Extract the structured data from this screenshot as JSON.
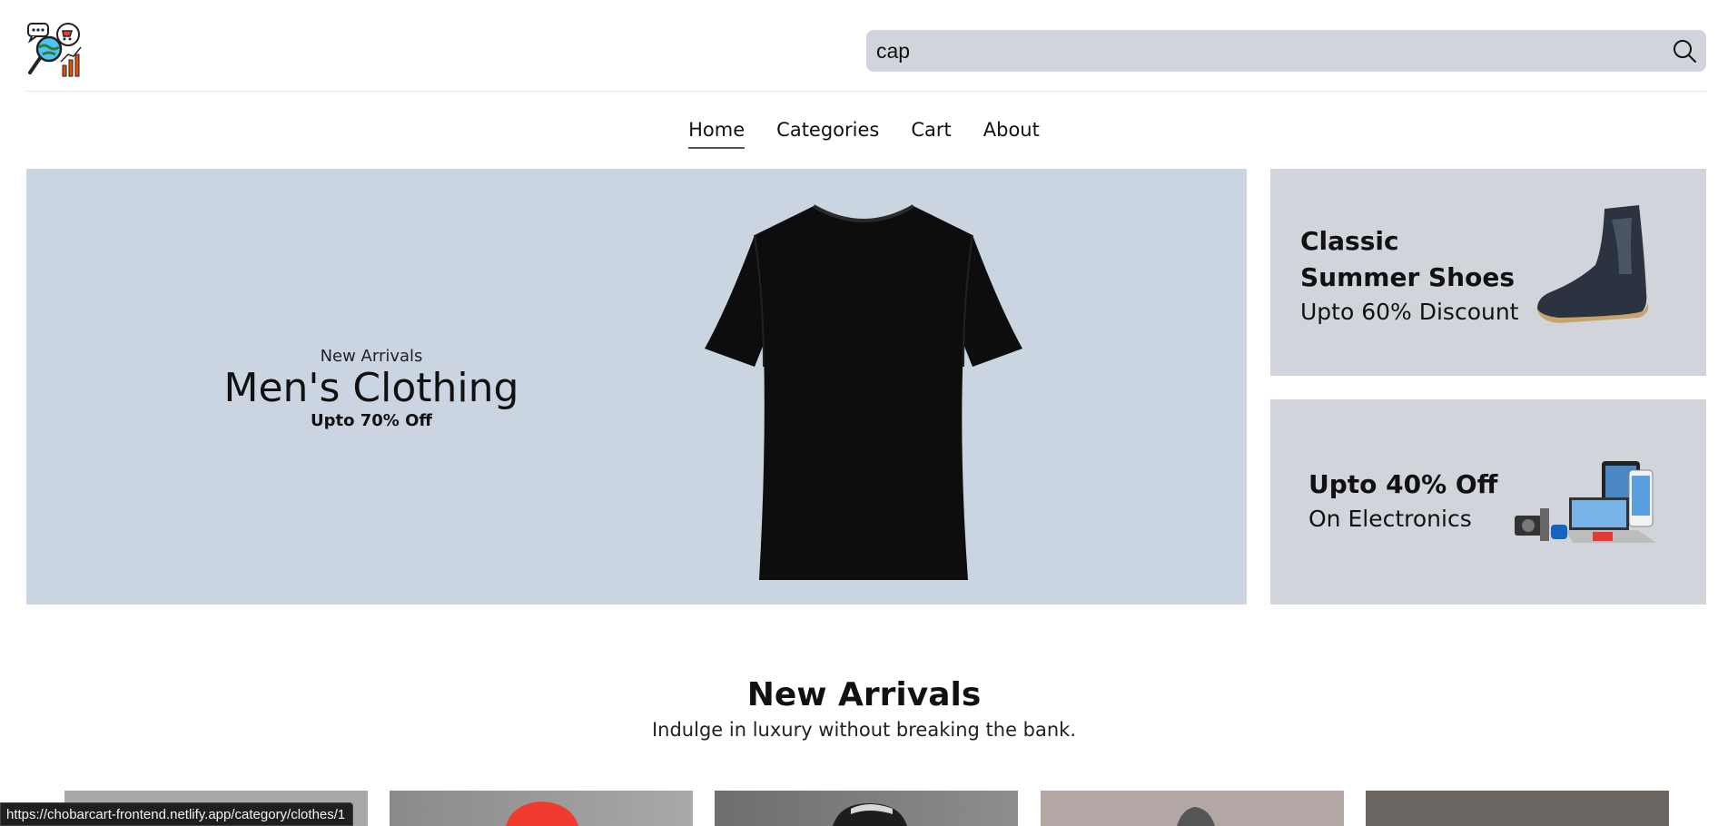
{
  "header": {
    "logo_icon": "shop-analytics-logo-icon",
    "search": {
      "value": "cap",
      "icon": "search-icon"
    }
  },
  "nav": {
    "items": [
      {
        "label": "Home",
        "active": true
      },
      {
        "label": "Categories",
        "active": false
      },
      {
        "label": "Cart",
        "active": false
      },
      {
        "label": "About",
        "active": false
      }
    ]
  },
  "hero": {
    "subtitle": "New Arrivals",
    "title": "Men's Clothing",
    "offer": "Upto 70% Off",
    "image_icon": "black-tshirt-image",
    "background": "#cbd5e1"
  },
  "promos": [
    {
      "title_line1": "Classic",
      "title_line2": "Summer Shoes",
      "subtitle": "Upto 60% Discount",
      "image_icon": "boot-image"
    },
    {
      "title": "Upto 40% Off",
      "subtitle": "On Electronics",
      "image_icon": "electronics-image"
    }
  ],
  "new_arrivals": {
    "title": "New Arrivals",
    "subtitle": "Indulge in luxury without breaking the bank."
  },
  "status_bar": {
    "url": "https://chobarcart-frontend.netlify.app/category/clothes/1"
  }
}
